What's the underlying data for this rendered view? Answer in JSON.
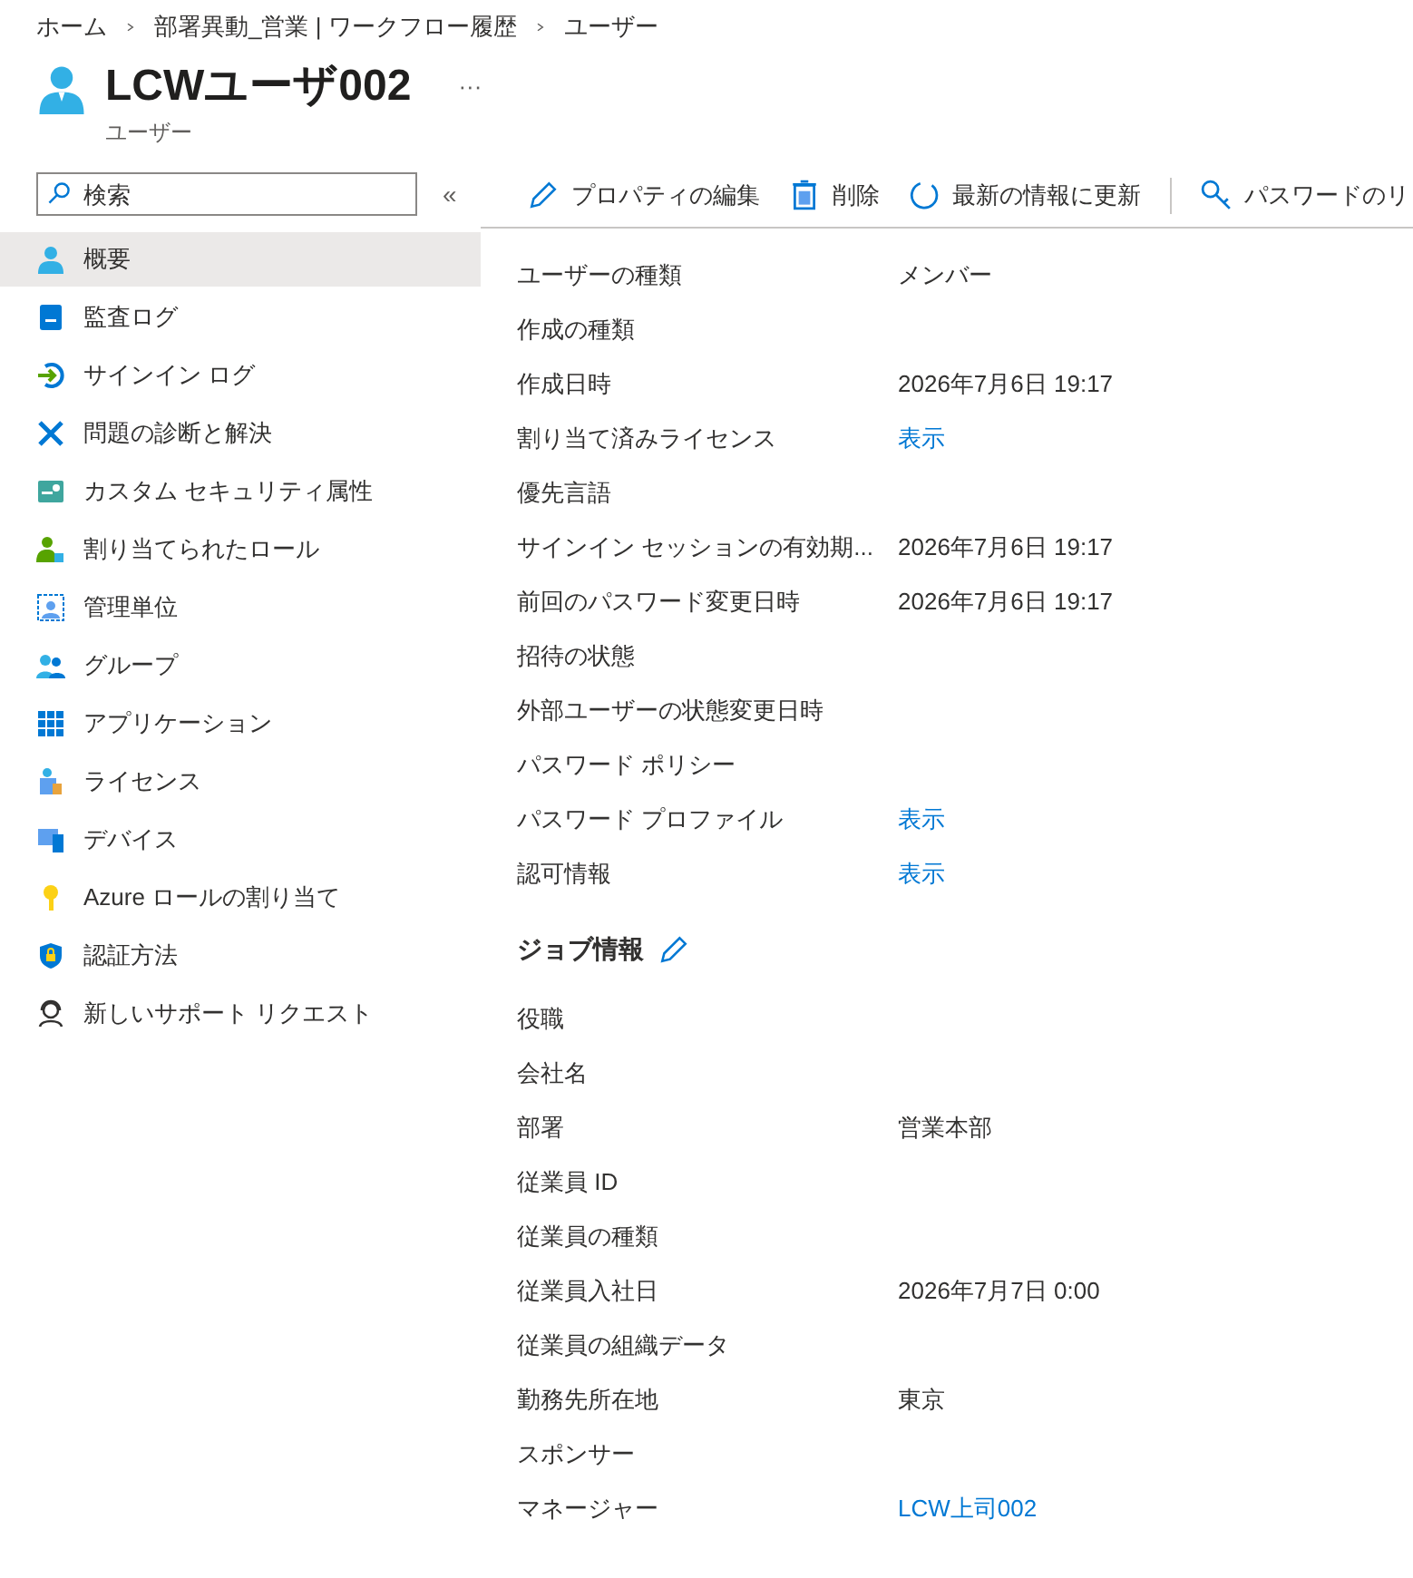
{
  "breadcrumb": [
    "ホーム",
    "部署異動_営業 | ワークフロー履歴",
    "ユーザー"
  ],
  "header": {
    "title": "LCWユーザ002",
    "subtitle": "ユーザー",
    "more": "···"
  },
  "search": {
    "placeholder": "検索"
  },
  "collapse": "«",
  "sidebar": {
    "items": [
      {
        "label": "概要",
        "selected": true
      },
      {
        "label": "監査ログ",
        "selected": false
      },
      {
        "label": "サインイン ログ",
        "selected": false
      },
      {
        "label": "問題の診断と解決",
        "selected": false
      },
      {
        "label": "カスタム セキュリティ属性",
        "selected": false
      },
      {
        "label": "割り当てられたロール",
        "selected": false
      },
      {
        "label": "管理単位",
        "selected": false
      },
      {
        "label": "グループ",
        "selected": false
      },
      {
        "label": "アプリケーション",
        "selected": false
      },
      {
        "label": "ライセンス",
        "selected": false
      },
      {
        "label": "デバイス",
        "selected": false
      },
      {
        "label": "Azure ロールの割り当て",
        "selected": false
      },
      {
        "label": "認証方法",
        "selected": false
      },
      {
        "label": "新しいサポート リクエスト",
        "selected": false
      }
    ]
  },
  "toolbar": [
    {
      "label": "プロパティの編集"
    },
    {
      "label": "削除"
    },
    {
      "label": "最新の情報に更新"
    },
    {
      "label": "パスワードのリ"
    }
  ],
  "properties": [
    {
      "label": "ユーザーの種類",
      "value": "メンバー",
      "kind": "text"
    },
    {
      "label": "作成の種類"
    },
    {
      "label": "作成日時",
      "value": "2026年7月6日 19:17",
      "kind": "text"
    },
    {
      "label": "割り当て済みライセンス",
      "value": "表示",
      "kind": "link"
    },
    {
      "label": "優先言語"
    },
    {
      "label": "サインイン セッションの有効期...",
      "value": "2026年7月6日 19:17",
      "kind": "text"
    },
    {
      "label": "前回のパスワード変更日時",
      "value": "2026年7月6日 19:17",
      "kind": "text"
    },
    {
      "label": "招待の状態"
    },
    {
      "label": "外部ユーザーの状態変更日時"
    },
    {
      "label": "パスワード ポリシー"
    },
    {
      "label": "パスワード プロファイル",
      "value": "表示",
      "kind": "link"
    },
    {
      "label": "認可情報",
      "value": "表示",
      "kind": "link"
    }
  ],
  "job_section": {
    "title": "ジョブ情報",
    "rows": [
      {
        "label": "役職"
      },
      {
        "label": "会社名"
      },
      {
        "label": "部署",
        "value": "営業本部",
        "kind": "text"
      },
      {
        "label": "従業員 ID"
      },
      {
        "label": "従業員の種類"
      },
      {
        "label": "従業員入社日",
        "value": "2026年7月7日 0:00",
        "kind": "text"
      },
      {
        "label": "従業員の組織データ"
      },
      {
        "label": "勤務先所在地",
        "value": "東京",
        "kind": "text"
      },
      {
        "label": "スポンサー"
      },
      {
        "label": "マネージャー",
        "value": "LCW上司002",
        "kind": "link"
      }
    ]
  }
}
